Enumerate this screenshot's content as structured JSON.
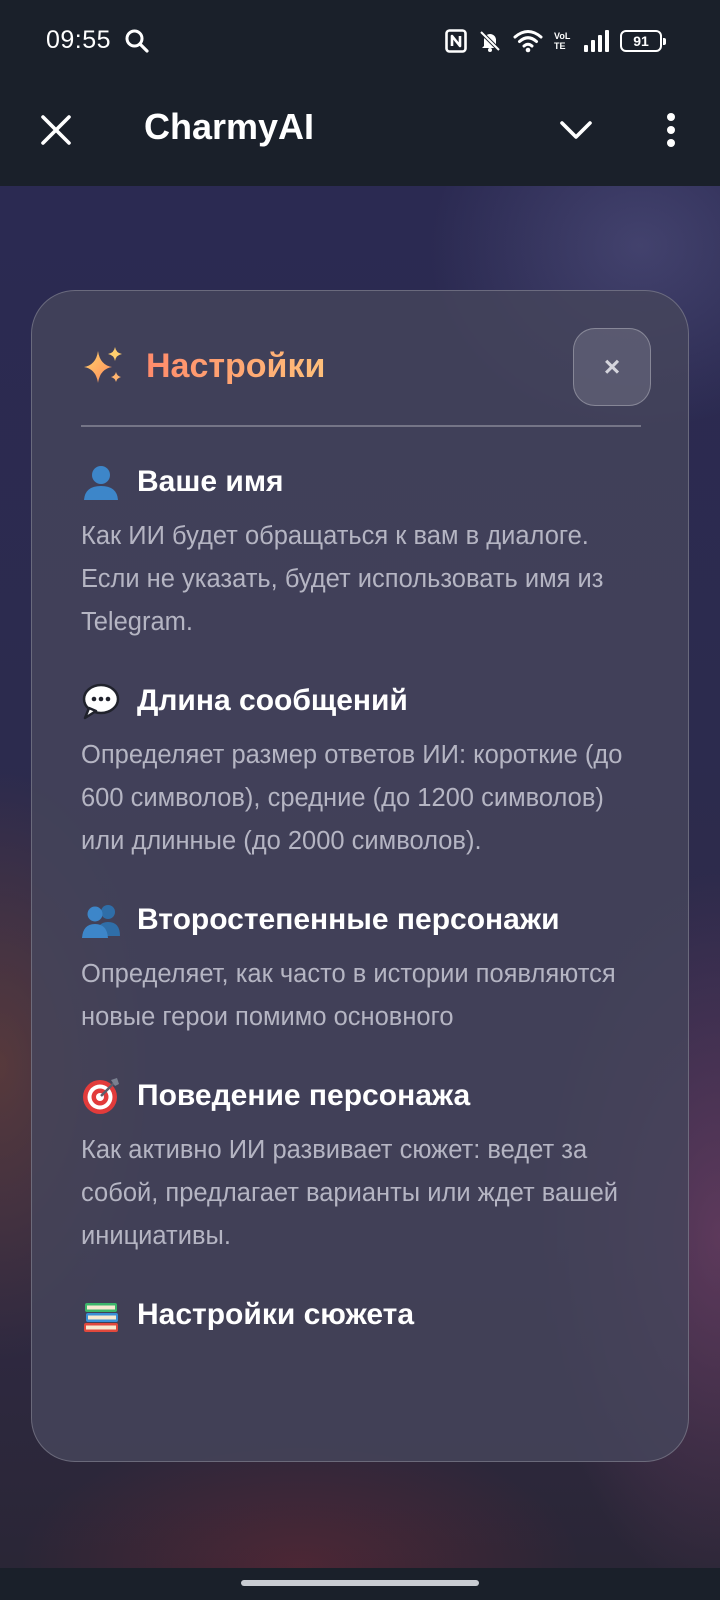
{
  "status_bar": {
    "time": "09:55",
    "network": "VoLTE",
    "battery": "91"
  },
  "app_bar": {
    "title": "CharmyAI"
  },
  "modal": {
    "title": "Настройки",
    "close_label": "×",
    "sections": [
      {
        "icon": "user-icon",
        "title": "Ваше имя",
        "description": "Как ИИ будет обращаться к вам в диалоге. Если не указать, будет использовать имя из Telegram."
      },
      {
        "icon": "speech-bubble-icon",
        "title": "Длина сообщений",
        "description": "Определяет размер ответов ИИ: короткие (до 600 символов), средние (до 1200 символов) или длинные (до 2000 символов)."
      },
      {
        "icon": "users-icon",
        "title": "Второстепенные персонажи",
        "description": "Определяет, как часто в истории появляются новые герои помимо основного"
      },
      {
        "icon": "target-icon",
        "title": "Поведение персонажа",
        "description": "Как активно ИИ развивает сюжет: ведет за собой, предлагает варианты или ждет вашей инициативы."
      },
      {
        "icon": "books-icon",
        "title": "Настройки сюжета",
        "description": ""
      }
    ]
  },
  "colors": {
    "title_gradient_start": "#ff8b6b",
    "title_gradient_end": "#ffc07a",
    "description_text": "#b5b5c3",
    "bar_background": "#1a202a"
  }
}
